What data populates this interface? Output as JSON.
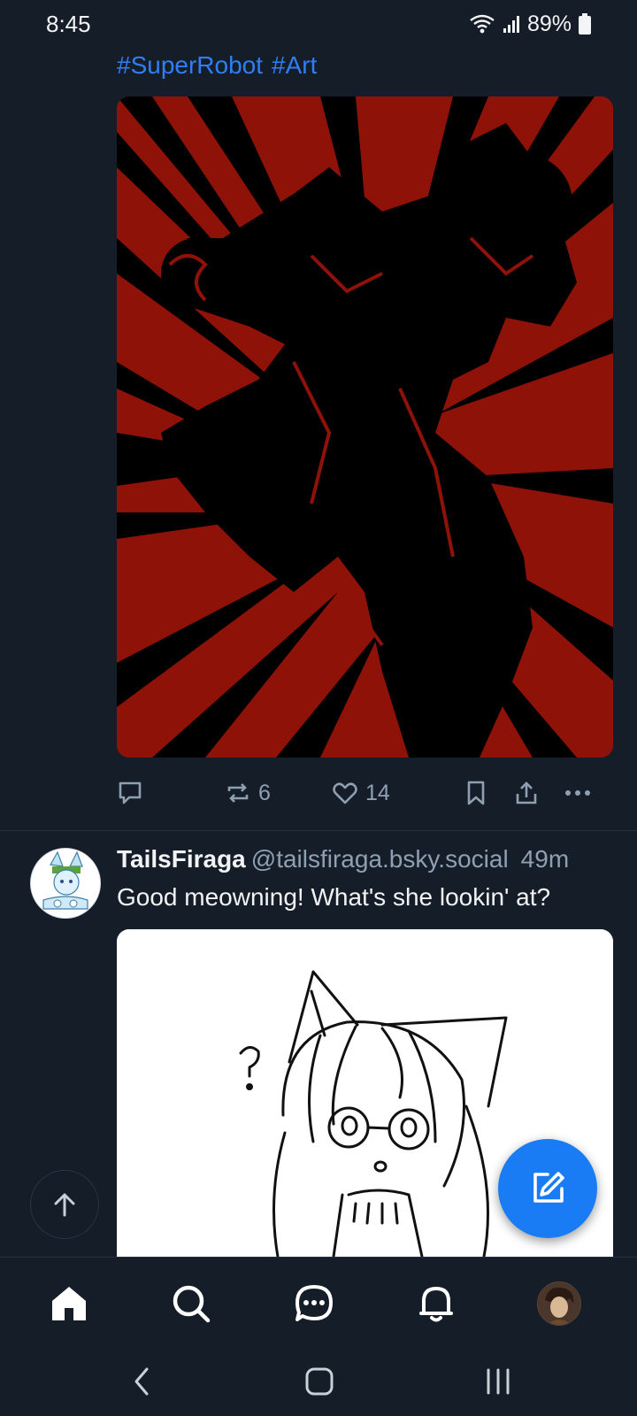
{
  "status_bar": {
    "time": "8:45",
    "battery": "89%",
    "icons": [
      "wifi-icon",
      "signal-icon",
      "battery-icon"
    ]
  },
  "post1": {
    "hashtags": [
      "#SuperRobot",
      "#Art"
    ],
    "media_description_icon": "image",
    "actions": {
      "reply_icon": "reply-icon",
      "repost_count": "6",
      "like_count": "14",
      "bookmark_icon": "bookmark-icon",
      "share_icon": "share-icon",
      "more_icon": "more-icon"
    }
  },
  "post2": {
    "display_name": "TailsFiraga",
    "handle": "@tailsfiraga.bsky.social",
    "timestamp": "49m",
    "text": "Good meowning! What's she lookin' at?",
    "question_mark": "?"
  },
  "floating": {
    "scroll_top_icon": "arrow-up-icon",
    "compose_icon": "compose-icon"
  },
  "bottom_nav": {
    "items": [
      "home-icon",
      "search-icon",
      "chat-icon",
      "bell-icon",
      "profile-avatar"
    ]
  },
  "system_nav": [
    "back-icon",
    "home-circle-icon",
    "recents-icon"
  ],
  "colors": {
    "background": "#151d28",
    "accent": "#1a7cf5",
    "hashtag": "#2f7ef5",
    "muted": "#8fa0b3",
    "media1_bg": "#8f1208"
  }
}
